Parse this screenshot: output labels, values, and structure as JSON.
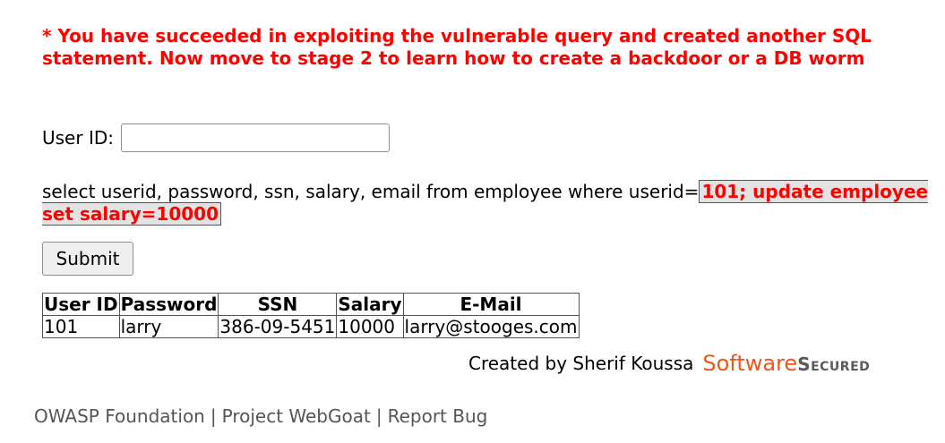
{
  "message": {
    "success": "* You have succeeded in exploiting the vulnerable query and created another SQL statement. Now move to stage 2 to learn how to create a backdoor or a DB worm"
  },
  "form": {
    "userid_label": "User ID:",
    "userid_value": "",
    "query_prefix": "select userid, password, ssn, salary, email from employee where userid=",
    "query_injected": "101; update employee set salary=10000",
    "submit_label": "Submit"
  },
  "table": {
    "headers": [
      "User ID",
      "Password",
      "SSN",
      "Salary",
      "E-Mail"
    ],
    "rows": [
      [
        "101",
        "larry",
        "386-09-5451",
        "10000",
        "larry@stooges.com"
      ]
    ]
  },
  "credit": {
    "text": "Created by Sherif Koussa",
    "logo_software": "Software",
    "logo_secured": "Secured"
  },
  "footer": {
    "links": [
      "OWASP Foundation",
      "Project WebGoat",
      "Report Bug"
    ],
    "separator": "|"
  },
  "colors": {
    "alert": "#ff0000",
    "logo_orange": "#e8571f",
    "footer_gray": "#555555"
  }
}
